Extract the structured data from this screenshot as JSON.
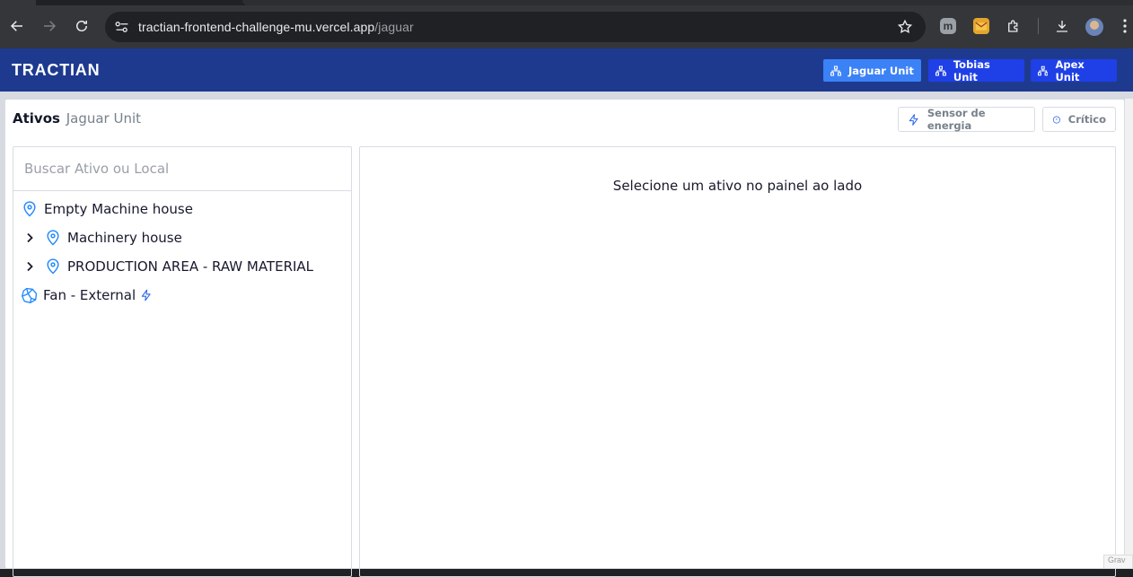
{
  "browser": {
    "url_host": "tractian-frontend-challenge-mu.vercel.app",
    "url_path": "/jaguar",
    "extension_m_label": "m"
  },
  "app": {
    "logo_text": "TRACTIAN",
    "units": [
      {
        "label": "Jaguar Unit",
        "active": true
      },
      {
        "label": "Tobias Unit",
        "active": false
      },
      {
        "label": "Apex Unit",
        "active": false
      }
    ]
  },
  "page": {
    "title_strong": "Ativos",
    "title_unit": "Jaguar Unit",
    "filters": [
      {
        "label": "Sensor de energia",
        "icon": "bolt-icon"
      },
      {
        "label": "Crítico",
        "icon": "info-circle-icon"
      }
    ]
  },
  "tree": {
    "search_placeholder": "Buscar Ativo ou Local",
    "items": [
      {
        "label": "Empty Machine house",
        "icon": "location-pin-icon",
        "expandable": false
      },
      {
        "label": "Machinery house",
        "icon": "location-pin-icon",
        "expandable": true
      },
      {
        "label": "PRODUCTION AREA - RAW MATERIAL",
        "icon": "location-pin-icon",
        "expandable": true
      },
      {
        "label": "Fan - External",
        "icon": "component-icon",
        "expandable": false,
        "energy_sensor": true
      }
    ]
  },
  "detail": {
    "empty_message": "Selecione um ativo no painel ao lado"
  },
  "corner_badge_text": "Grav",
  "colors": {
    "header_bg": "#1e3a8f",
    "unit_button": "#1e40e6",
    "unit_button_active": "#3b82f6",
    "icon_blue": "#2188ff"
  }
}
